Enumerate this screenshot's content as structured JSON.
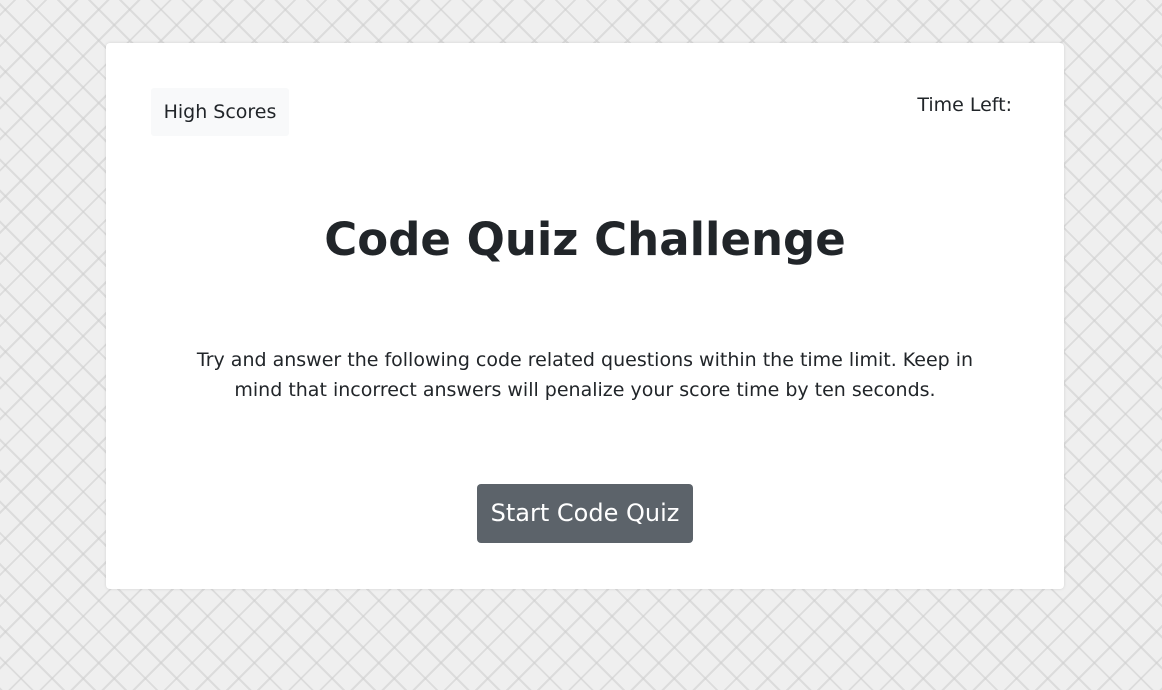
{
  "header": {
    "high_scores_label": "High Scores",
    "timer_label": "Time Left:"
  },
  "main": {
    "title": "Code Quiz Challenge",
    "intro": "Try and answer the following code related questions within the time limit. Keep in mind that incorrect answers will penalize your score time by ten seconds.",
    "start_label": "Start Code Quiz"
  },
  "colors": {
    "background": "#efefef",
    "card": "#ffffff",
    "secondary_button": "#5c636a",
    "light_button": "#f8f9fa",
    "text": "#212529"
  }
}
